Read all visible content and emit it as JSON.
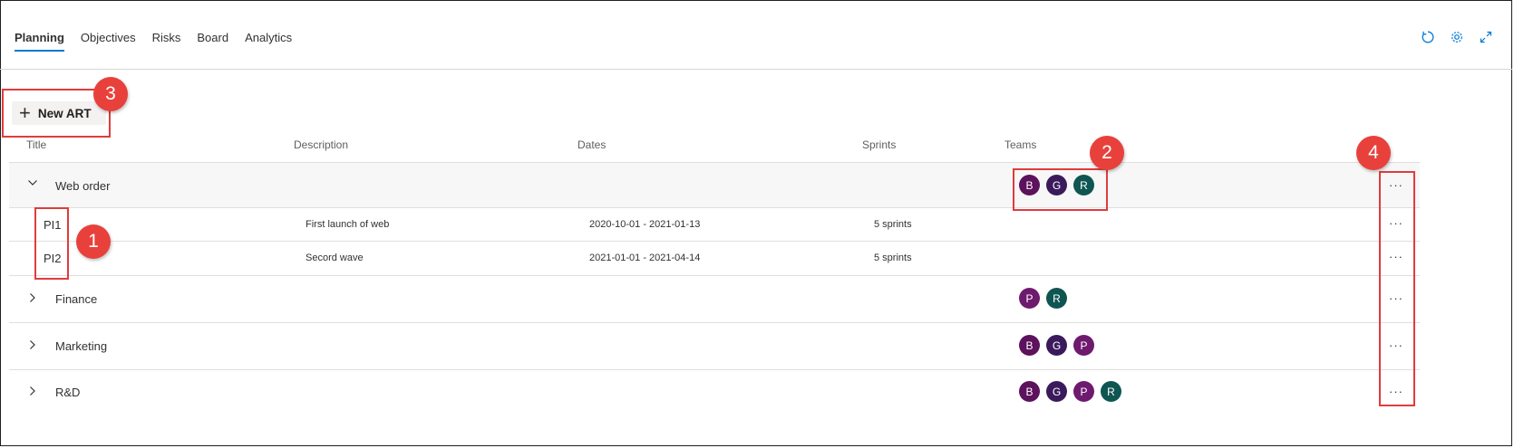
{
  "tabs": [
    {
      "label": "Planning",
      "active": true
    },
    {
      "label": "Objectives"
    },
    {
      "label": "Risks"
    },
    {
      "label": "Board"
    },
    {
      "label": "Analytics"
    }
  ],
  "toolbar": {
    "new_button_label": "New ART",
    "icons": [
      "refresh-icon",
      "settings-icon",
      "expand-icon"
    ]
  },
  "columns": {
    "title": "Title",
    "description": "Description",
    "dates": "Dates",
    "sprints": "Sprints",
    "teams": "Teams"
  },
  "groups": [
    {
      "title": "Web order",
      "expanded": true,
      "teams": [
        "B",
        "G",
        "R"
      ],
      "items": [
        {
          "title": "PI1",
          "description": "First launch of web",
          "dates": "2020-10-01 - 2021-01-13",
          "sprints": "5 sprints"
        },
        {
          "title": "PI2",
          "description": "Secord wave",
          "dates": "2021-01-01 - 2021-04-14",
          "sprints": "5 sprints"
        }
      ]
    },
    {
      "title": "Finance",
      "expanded": false,
      "teams": [
        "P",
        "R"
      ]
    },
    {
      "title": "Marketing",
      "expanded": false,
      "teams": [
        "B",
        "G",
        "P"
      ]
    },
    {
      "title": "R&D",
      "expanded": false,
      "teams": [
        "B",
        "G",
        "P",
        "R"
      ]
    }
  ],
  "more_label": "···",
  "team_colors": {
    "B": "#5c125c",
    "G": "#3b1a5c",
    "P": "#6e1a6e",
    "R": "#0f5552"
  },
  "annotation_colors": {
    "highlight": "#e03c3c",
    "badge": "#e8413c"
  },
  "annotations": [
    "1",
    "2",
    "3",
    "4"
  ]
}
